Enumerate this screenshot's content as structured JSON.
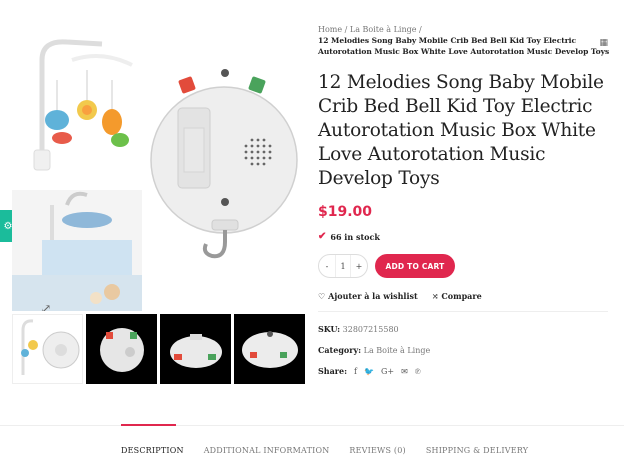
{
  "breadcrumb": {
    "home": "Home",
    "sep1": "/",
    "category": "La Boite à Linge",
    "sep2": "/",
    "current": "12 Melodies Song Baby Mobile Crib Bed Bell Kid Toy Electric Autorotation Music Box White Love Autorotation Music Develop Toys"
  },
  "product": {
    "title": "12 Melodies Song Baby Mobile Crib Bed Bell Kid Toy Electric Autorotation Music Box White Love Autorotation Music Develop Toys",
    "price": "$19.00",
    "stock": "66 in stock",
    "quantity": "1",
    "qty_minus": "-",
    "qty_plus": "+",
    "add_to_cart": "ADD TO CART",
    "wishlist": "Ajouter à la wishlist",
    "compare": "Compare",
    "sku_label": "SKU:",
    "sku": "32807215580",
    "category_label": "Category:",
    "category": "La Boite à Linge",
    "share_label": "Share:"
  },
  "tabs": [
    "DESCRIPTION",
    "ADDITIONAL INFORMATION",
    "REVIEWS (0)",
    "SHIPPING & DELIVERY"
  ],
  "colors": {
    "accent": "#e0274e",
    "side_tab": "#1bbc9b"
  }
}
